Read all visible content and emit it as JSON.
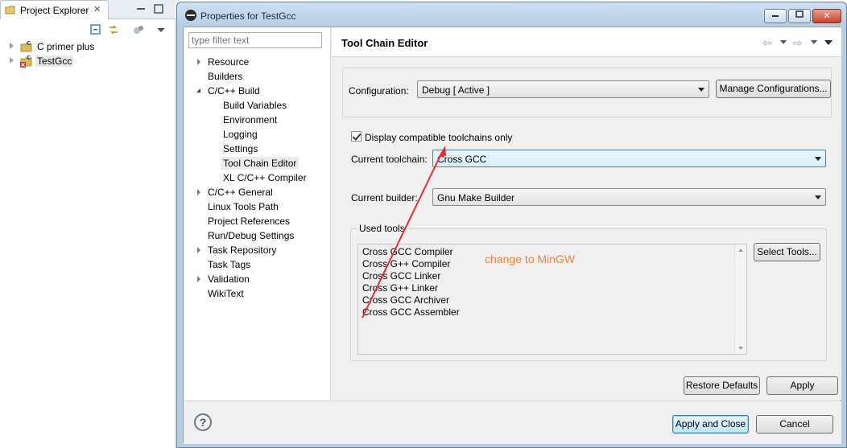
{
  "explorer": {
    "tab_label": "Project Explorer",
    "projects": [
      {
        "label": "C primer plus",
        "selected": false
      },
      {
        "label": "TestGcc",
        "selected": true
      }
    ]
  },
  "dialog": {
    "title": "Properties for TestGcc",
    "filter_placeholder": "type filter text",
    "nav": [
      {
        "label": "Resource",
        "twisty": "closed",
        "level": 0
      },
      {
        "label": "Builders",
        "twisty": "none",
        "level": 0
      },
      {
        "label": "C/C++ Build",
        "twisty": "open",
        "level": 0
      },
      {
        "label": "Build Variables",
        "twisty": "none",
        "level": 1
      },
      {
        "label": "Environment",
        "twisty": "none",
        "level": 1
      },
      {
        "label": "Logging",
        "twisty": "none",
        "level": 1
      },
      {
        "label": "Settings",
        "twisty": "none",
        "level": 1
      },
      {
        "label": "Tool Chain Editor",
        "twisty": "none",
        "level": 1,
        "selected": true
      },
      {
        "label": "XL C/C++ Compiler",
        "twisty": "none",
        "level": 1
      },
      {
        "label": "C/C++ General",
        "twisty": "closed",
        "level": 0
      },
      {
        "label": "Linux Tools Path",
        "twisty": "none",
        "level": 0
      },
      {
        "label": "Project References",
        "twisty": "none",
        "level": 0
      },
      {
        "label": "Run/Debug Settings",
        "twisty": "none",
        "level": 0
      },
      {
        "label": "Task Repository",
        "twisty": "closed",
        "level": 0
      },
      {
        "label": "Task Tags",
        "twisty": "none",
        "level": 0
      },
      {
        "label": "Validation",
        "twisty": "closed",
        "level": 0
      },
      {
        "label": "WikiText",
        "twisty": "none",
        "level": 0
      }
    ],
    "page": {
      "title": "Tool Chain Editor",
      "configuration_label": "Configuration:",
      "configuration_value": "Debug  [ Active ]",
      "manage_button": "Manage Configurations...",
      "compatible_checkbox_label": "Display compatible toolchains only",
      "compatible_checked": true,
      "toolchain_label": "Current toolchain:",
      "toolchain_value": "Cross GCC",
      "builder_label": "Current builder:",
      "builder_value": "Gnu Make Builder",
      "used_tools_label": "Used tools",
      "tools": [
        "Cross GCC Compiler",
        "Cross G++ Compiler",
        "Cross GCC Linker",
        "Cross G++ Linker",
        "Cross GCC Archiver",
        "Cross GCC Assembler"
      ],
      "select_tools_button": "Select Tools...",
      "restore_defaults_button": "Restore Defaults",
      "apply_button": "Apply"
    },
    "footer": {
      "help_glyph": "?",
      "apply_close_button": "Apply and Close",
      "cancel_button": "Cancel"
    }
  },
  "annotation": {
    "text": "change to MinGW",
    "color": "#f0843c",
    "arrow_color": "#e8302c"
  }
}
